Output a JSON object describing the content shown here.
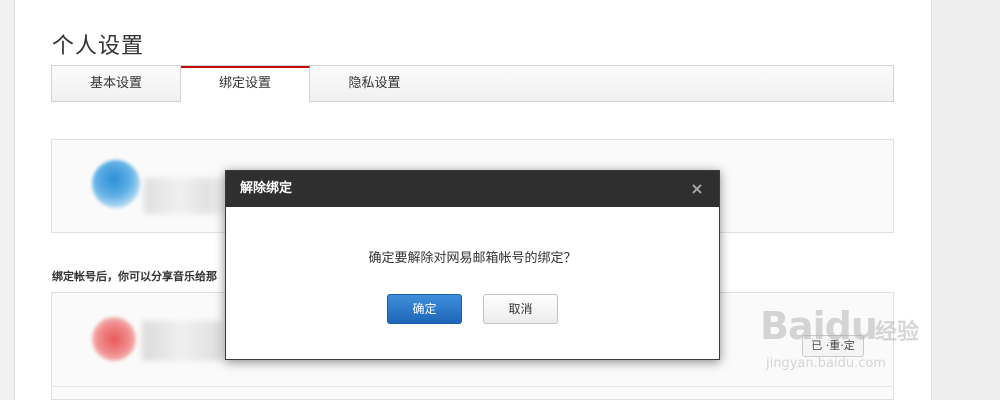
{
  "page": {
    "title": "个人设置"
  },
  "tabs": [
    {
      "label": "基本设置",
      "active": false
    },
    {
      "label": "绑定设置",
      "active": true
    },
    {
      "label": "隐私设置",
      "active": false
    }
  ],
  "hint": {
    "text": "绑定帐号后，你可以分享音乐给那"
  },
  "second_row": {
    "button_label": "已 ·重·定"
  },
  "dialog": {
    "title": "解除绑定",
    "close_glyph": "×",
    "message": "确定要解除对网易邮箱帐号的绑定？",
    "confirm_label": "确定",
    "cancel_label": "取消"
  },
  "watermark": {
    "brand": "Baidu",
    "brand_sub": "经验",
    "url": "jingyan.baidu.com"
  },
  "colors": {
    "accent": "#c20c0c",
    "dialog_header": "#2f2f2f",
    "confirm_button": "#1d67b8"
  }
}
